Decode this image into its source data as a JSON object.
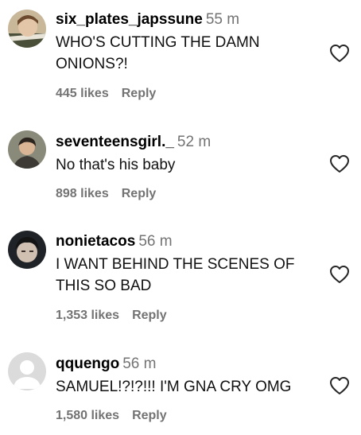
{
  "comments": [
    {
      "username": "six_plates_japssune",
      "time": "55 m",
      "text": "WHO'S CUTTING THE DAMN ONIONS?!",
      "likes": "445 likes",
      "reply": "Reply",
      "avatar_icon": "user-photo-avatar"
    },
    {
      "username": "seventeensgirl._",
      "time": "52 m",
      "text": "No that's his baby",
      "likes": "898 likes",
      "reply": "Reply",
      "avatar_icon": "user-photo-avatar"
    },
    {
      "username": "nonietacos",
      "time": "56 m",
      "text": "I WANT BEHIND THE SCENES OF THIS SO BAD",
      "likes": "1,353 likes",
      "reply": "Reply",
      "avatar_icon": "user-photo-avatar"
    },
    {
      "username": "qquengo",
      "time": "56 m",
      "text": "SAMUEL!?!?!!! I'M GNA CRY OMG",
      "likes": "1,580 likes",
      "reply": "Reply",
      "avatar_icon": "default-avatar-icon"
    }
  ],
  "colors": {
    "secondary_text": "#737373",
    "heart_stroke": "#262626"
  }
}
